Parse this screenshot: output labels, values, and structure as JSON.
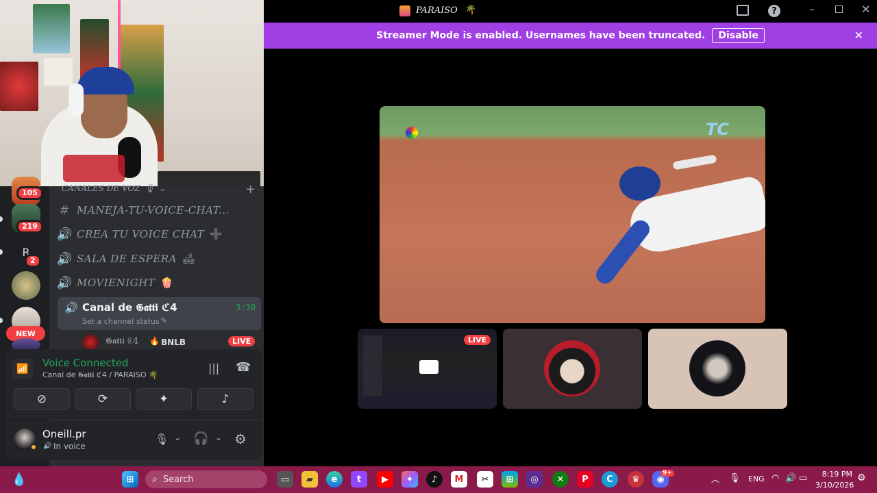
{
  "window": {
    "title": "PARAISO",
    "title_emoji": "🌴"
  },
  "streamer_banner": {
    "message": "Streamer Mode is enabled. Usernames have been truncated.",
    "disable_label": "Disable"
  },
  "server_rail": {
    "badges": [
      "105",
      "219",
      "2"
    ],
    "letter_server": "R",
    "new_label": "NEW"
  },
  "channels": {
    "category": "CANALES DE VOZ",
    "category_emoji": "🎙",
    "items": [
      {
        "type": "text",
        "name": "MANEJA-TU-VOICE-CHAT..."
      },
      {
        "type": "voice",
        "name": "CREA TU VOICE CHAT",
        "emoji": "➕"
      },
      {
        "type": "voice",
        "name": "SALA DE ESPERA",
        "emoji": "🛋"
      },
      {
        "type": "voice",
        "name": "MOVIENIGHT",
        "emoji": "🍿"
      }
    ],
    "active": {
      "name": "Canal de 𝕲𝖆𝖙𝖙𝖎 ℭ4",
      "time": "3:30",
      "status_placeholder": "Set a channel status"
    },
    "member": {
      "name": "𝕲𝖆𝖙𝖙𝖎 ℭ4",
      "tag": "BNLB",
      "live_label": "LIVE"
    }
  },
  "voice_panel": {
    "status": "Voice Connected",
    "location": "Canal de 𝕲𝖆𝖙𝖙𝖎 ℭ4 / PARAISO 🌴",
    "accent": "#23a55a"
  },
  "user": {
    "name": "Oneill.pr",
    "status": "In voice"
  },
  "stage": {
    "live_label": "LIVE"
  },
  "taskbar": {
    "search_placeholder": "Search",
    "language": "ENG",
    "time": "8:19 PM",
    "date": "3/10/2026",
    "discord_badge": "9+"
  },
  "colors": {
    "banner": "#a03fe3",
    "live": "#f23f43",
    "taskbar": "#8a1a4a"
  }
}
